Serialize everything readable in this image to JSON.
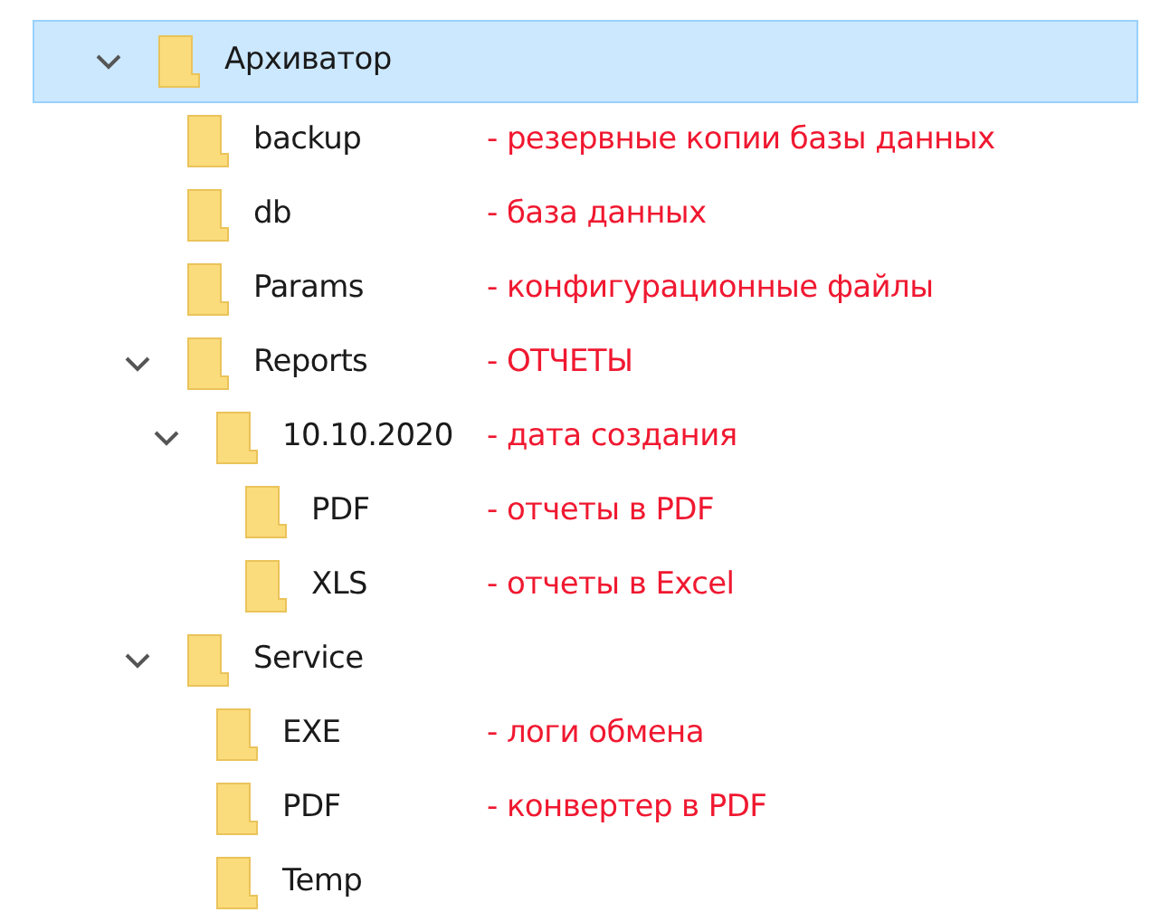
{
  "tree": [
    {
      "name": "Архиватор",
      "selected": true,
      "expanded": true,
      "children": [
        {
          "name": "backup",
          "selected": false,
          "note": "- резервные копии базы данных"
        },
        {
          "name": "db",
          "selected": false,
          "note": "- база данных"
        },
        {
          "name": "Params",
          "selected": false,
          "note": "- конфигурационные файлы"
        },
        {
          "name": "Reports",
          "selected": false,
          "expanded": true,
          "note": "- ОТЧЕТЫ",
          "children": [
            {
              "name": "10.10.2020",
              "selected": false,
              "expanded": true,
              "note": "- дата создания",
              "children": [
                {
                  "name": "PDF",
                  "selected": false,
                  "note": "- отчеты в PDF"
                },
                {
                  "name": "XLS",
                  "selected": false,
                  "note": "- отчеты в Excel"
                }
              ]
            }
          ]
        },
        {
          "name": "Service",
          "selected": false,
          "expanded": true,
          "children": [
            {
              "name": "EXE",
              "selected": false,
              "note": "- логи обмена"
            },
            {
              "name": "PDF",
              "selected": false,
              "note": "- конвертер в PDF"
            },
            {
              "name": "Temp",
              "selected": false
            }
          ]
        }
      ]
    }
  ]
}
